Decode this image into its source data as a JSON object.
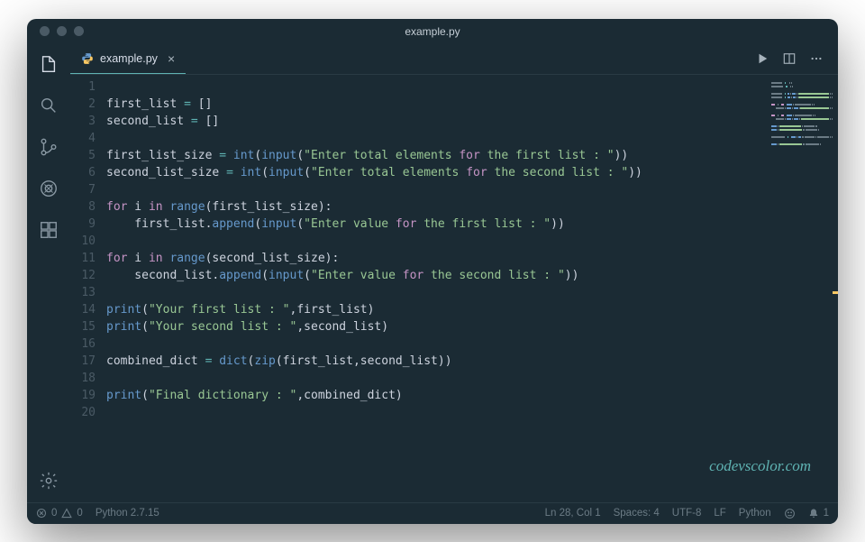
{
  "window": {
    "title": "example.py"
  },
  "tab": {
    "filename": "example.py"
  },
  "code": {
    "lines": [
      "",
      "first_list = []",
      "second_list = []",
      "",
      "first_list_size = int(input(\"Enter total elements for the first list : \"))",
      "second_list_size = int(input(\"Enter total elements for the second list : \"))",
      "",
      "for i in range(first_list_size):",
      "    first_list.append(input(\"Enter value for the first list : \"))",
      "",
      "for i in range(second_list_size):",
      "    second_list.append(input(\"Enter value for the second list : \"))",
      "",
      "print(\"Your first list : \",first_list)",
      "print(\"Your second list : \",second_list)",
      "",
      "combined_dict = dict(zip(first_list,second_list))",
      "",
      "print(\"Final dictionary : \",combined_dict)",
      ""
    ]
  },
  "status": {
    "errors": "0",
    "warnings": "0",
    "language_version": "Python 2.7.15",
    "cursor": "Ln 28, Col 1",
    "spaces": "Spaces: 4",
    "encoding": "UTF-8",
    "eol": "LF",
    "language": "Python",
    "notifications": "1"
  },
  "watermark": "codevscolor.com"
}
